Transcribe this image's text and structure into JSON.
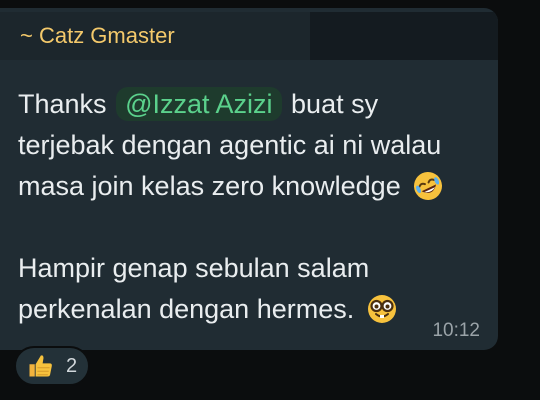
{
  "message": {
    "sender": "~ Catz Gmaster",
    "line1_before": "Thanks",
    "mention": "@Izzat Azizi",
    "line1_after": "buat sy",
    "line2": "terjebak dengan agentic ai ni walau",
    "line3": "masa join kelas zero knowledge",
    "line3_emoji": "rolling-on-floor-laughing-emoji",
    "line4": "Hampir genap sebulan salam",
    "line5": "perkenalan dengan hermes.",
    "line5_emoji": "nerd-face-emoji",
    "timestamp": "10:12"
  },
  "reaction": {
    "emoji": "thumbs-up-emoji",
    "count": "2"
  },
  "colors": {
    "bubble": "#202c33",
    "sender_name": "#f4c96b",
    "mention_text": "#5bd18c",
    "mention_bg": "#1e3b2d",
    "text": "#e9edef",
    "timestamp": "#9aa3a8"
  }
}
